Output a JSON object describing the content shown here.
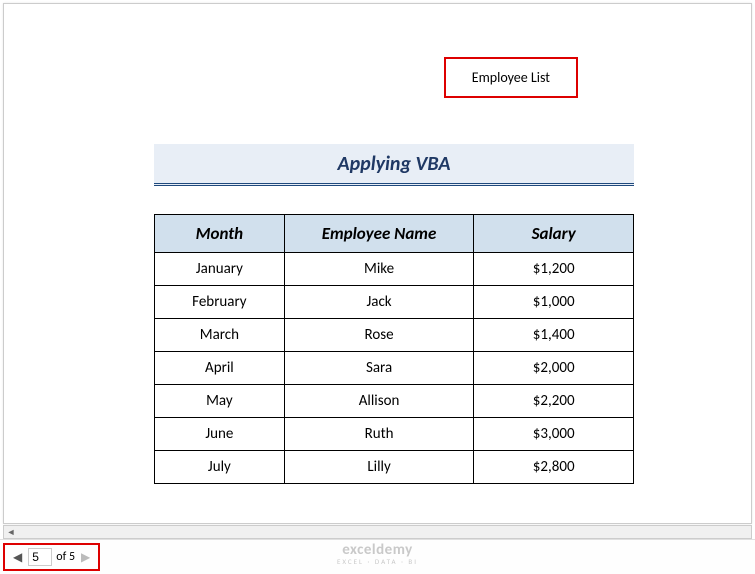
{
  "header": {
    "label": "Employee List"
  },
  "title": "Applying VBA",
  "table": {
    "headers": {
      "month": "Month",
      "name": "Employee Name",
      "salary": "Salary"
    },
    "rows": [
      {
        "month": "January",
        "name": "Mike",
        "salary": "$1,200"
      },
      {
        "month": "February",
        "name": "Jack",
        "salary": "$1,000"
      },
      {
        "month": "March",
        "name": "Rose",
        "salary": "$1,400"
      },
      {
        "month": "April",
        "name": "Sara",
        "salary": "$2,000"
      },
      {
        "month": "May",
        "name": "Allison",
        "salary": "$2,200"
      },
      {
        "month": "June",
        "name": "Ruth",
        "salary": "$3,000"
      },
      {
        "month": "July",
        "name": "Lilly",
        "salary": "$2,800"
      }
    ]
  },
  "pager": {
    "current": "5",
    "of_label": "of 5"
  },
  "watermark": {
    "main": "exceldemy",
    "sub": "EXCEL · DATA · BI"
  }
}
